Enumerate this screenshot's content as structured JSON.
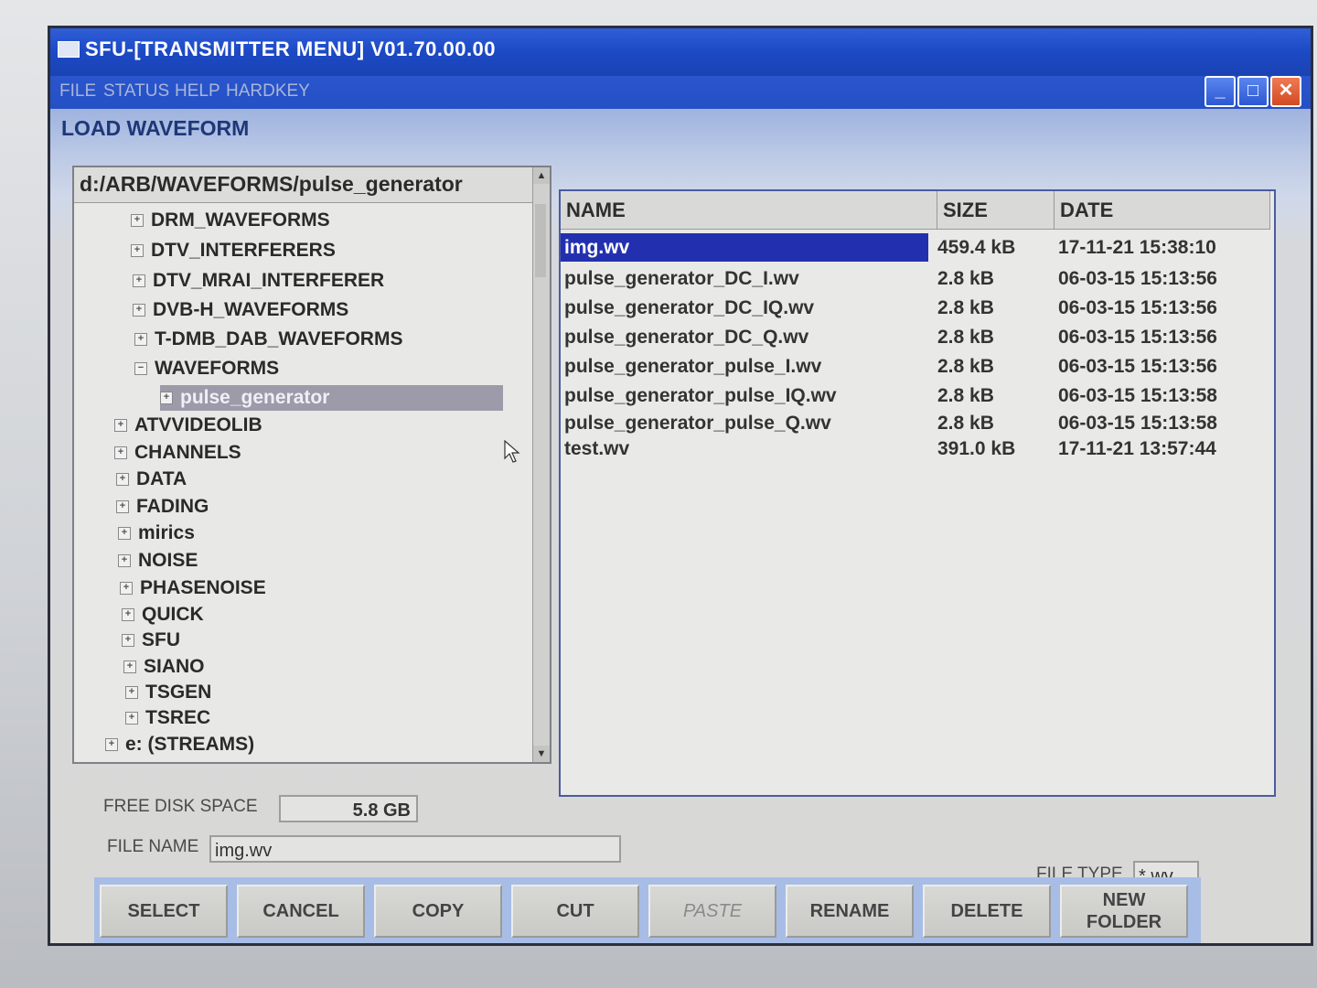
{
  "window": {
    "title": "SFU-[TRANSMITTER MENU]  V01.70.00.00",
    "buttons": {
      "minimize": "_",
      "maximize": "□",
      "close": "✕"
    }
  },
  "menu": [
    "FILE",
    "STATUS",
    "HELP",
    "HARDKEY"
  ],
  "section_title": "LOAD WAVEFORM",
  "tree": {
    "path": "d:/ARB/WAVEFORMS/pulse_generator",
    "items": [
      {
        "label": "DRM_WAVEFORMS",
        "level": 2
      },
      {
        "label": "DTV_INTERFERERS",
        "level": 2
      },
      {
        "label": "DTV_MRAI_INTERFERER",
        "level": 2
      },
      {
        "label": "DVB-H_WAVEFORMS",
        "level": 2
      },
      {
        "label": "T-DMB_DAB_WAVEFORMS",
        "level": 2
      },
      {
        "label": "WAVEFORMS",
        "level": 2,
        "expanded": true
      },
      {
        "label": "pulse_generator",
        "level": 3,
        "selected": true
      },
      {
        "label": "ATVVIDEOLIB",
        "level": 1
      },
      {
        "label": "CHANNELS",
        "level": 1
      },
      {
        "label": "DATA",
        "level": 1
      },
      {
        "label": "FADING",
        "level": 1
      },
      {
        "label": "mirics",
        "level": 1
      },
      {
        "label": "NOISE",
        "level": 1
      },
      {
        "label": "PHASENOISE",
        "level": 1
      },
      {
        "label": "QUICK",
        "level": 1
      },
      {
        "label": "SFU",
        "level": 1
      },
      {
        "label": "SIANO",
        "level": 1
      },
      {
        "label": "TSGEN",
        "level": 1
      },
      {
        "label": "TSREC",
        "level": 1
      },
      {
        "label": "e: (STREAMS)",
        "level": 0
      }
    ]
  },
  "file_list": {
    "columns": {
      "name": "NAME",
      "size": "SIZE",
      "date": "DATE"
    },
    "rows": [
      {
        "name": "img.wv",
        "size": "459.4 kB",
        "date": "17-11-21 15:38:10",
        "selected": true
      },
      {
        "name": "pulse_generator_DC_I.wv",
        "size": "2.8 kB",
        "date": "06-03-15 15:13:56"
      },
      {
        "name": "pulse_generator_DC_IQ.wv",
        "size": "2.8 kB",
        "date": "06-03-15 15:13:56"
      },
      {
        "name": "pulse_generator_DC_Q.wv",
        "size": "2.8 kB",
        "date": "06-03-15 15:13:56"
      },
      {
        "name": "pulse_generator_pulse_I.wv",
        "size": "2.8 kB",
        "date": "06-03-15 15:13:56"
      },
      {
        "name": "pulse_generator_pulse_IQ.wv",
        "size": "2.8 kB",
        "date": "06-03-15 15:13:58"
      },
      {
        "name": "pulse_generator_pulse_Q.wv",
        "size": "2.8 kB",
        "date": "06-03-15 15:13:58"
      },
      {
        "name": "test.wv",
        "size": "391.0 kB",
        "date": "17-11-21 13:57:44"
      }
    ]
  },
  "free_disk_space": {
    "label": "FREE DISK SPACE",
    "value": "5.8 GB"
  },
  "file_name": {
    "label": "FILE NAME",
    "value": "img.wv"
  },
  "file_type": {
    "label": "FILE TYPE",
    "value": "*.wv"
  },
  "softkeys": [
    {
      "label": "SELECT"
    },
    {
      "label": "CANCEL"
    },
    {
      "label": "COPY"
    },
    {
      "label": "CUT"
    },
    {
      "label": "PASTE",
      "disabled": true
    },
    {
      "label": "RENAME"
    },
    {
      "label": "DELETE"
    },
    {
      "label": "NEW\nFOLDER"
    }
  ],
  "colors": {
    "titlebar": "#1c49c4",
    "selection": "#2230b0",
    "tree_selection": "#9d9aa9",
    "softkey_bar": "#a8bde6"
  }
}
